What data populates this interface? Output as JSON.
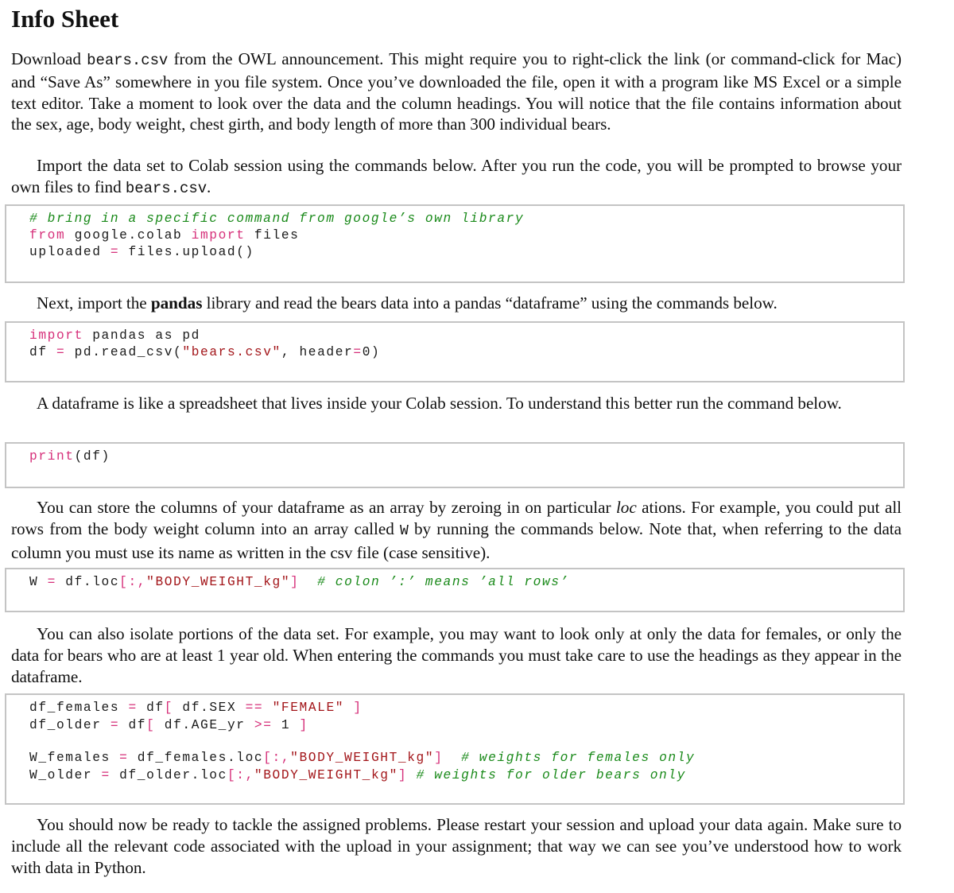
{
  "document": {
    "title": "Info Sheet",
    "sections": [
      {
        "id": "download",
        "paragraph_parts": {
          "p1_a": "Download ",
          "p1_code": "bears.csv",
          "p1_b": " from the OWL announcement. This might require you to right-click the link (or command-click for Mac) and “Save As” somewhere in you file system. Once you’ve downloaded the file, open it with a program like MS Excel or a simple text editor. Take a moment to look over the data and the column headings. You will notice that the file contains information about the sex, age, body weight, chest girth, and body length of more than 300 individual bears.",
          "p2_a": "Import the data set to Colab session using the commands below. After you run the code, you will be prompted to browse your own files to find ",
          "p2_code": "bears.csv",
          "p2_b": "."
        }
      },
      {
        "id": "pandas",
        "paragraph_parts": {
          "a": "Next, import the ",
          "bold": "pandas",
          "b": " library and read the bears data into a pandas “dataframe” using the commands below."
        }
      },
      {
        "id": "dataframe",
        "paragraph_parts": {
          "a": "A dataframe is like a spreadsheet that lives inside your Colab session. To understand this better run the command below."
        }
      },
      {
        "id": "loc",
        "paragraph_parts": {
          "a": "You can store the columns of your dataframe as an array by zeroing in on particular ",
          "italic": "loc",
          "b": " ations. For example, you could put all rows from the body weight column into an array called ",
          "code": "W",
          "c": " by running the commands below. Note that, when referring to the data column you must use its name as written in the csv file (case sensitive)."
        }
      },
      {
        "id": "isolate",
        "paragraph_parts": {
          "a": "You can also isolate portions of the data set. For example, you may want to look only at only the data for females, or only the data for bears who are at least 1 year old. When entering the commands you must take care to use the headings as they appear in the dataframe."
        }
      },
      {
        "id": "closing",
        "paragraph_parts": {
          "a": "You should now be ready to tackle the assigned problems. Please restart your session and upload your data again. Make sure to include all the relevant code associated with the upload in your assignment; that way we can see you’ve understood how to work with data in Python."
        }
      }
    ],
    "code_blocks": {
      "upload": {
        "l1_comment": "# bring in a specific command from google’s own library",
        "l2_kw1": "from",
        "l2_mid": " google.colab ",
        "l2_kw2": "import",
        "l2_end": " files",
        "l3_a": "uploaded ",
        "l3_op": "=",
        "l3_b": " files.upload()"
      },
      "read_csv": {
        "l1_kw": "import",
        "l1_end": " pandas as pd",
        "l2_a": "df ",
        "l2_op": "=",
        "l2_b": " pd.read_csv(",
        "l2_str": "\"bears.csv\"",
        "l2_c": ", header",
        "l2_op2": "=",
        "l2_d": "0)"
      },
      "print": {
        "l1_kw": "print",
        "l1_end": "(df)"
      },
      "loc": {
        "l1_a": "W ",
        "l1_op": "=",
        "l1_b": " df.loc",
        "l1_br1": "[:,",
        "l1_str": "\"BODY_WEIGHT_kg\"",
        "l1_br2": "]",
        "l1_sp": "  ",
        "l1_comment": "# colon ’:’ means ’all rows’"
      },
      "filters": {
        "l1_a": "df_females ",
        "l1_op": "=",
        "l1_b": " df",
        "l1_br1": "[",
        "l1_c": " df.SEX ",
        "l1_op2": "==",
        "l1_sp": " ",
        "l1_str": "\"FEMALE\"",
        "l1_sp2": " ",
        "l1_br2": "]",
        "l2_a": "df_older ",
        "l2_op": "=",
        "l2_b": " df",
        "l2_br1": "[",
        "l2_c": " df.AGE_yr ",
        "l2_op2": ">=",
        "l2_d": " 1 ",
        "l2_br2": "]",
        "l3_a": "W_females ",
        "l3_op": "=",
        "l3_b": " df_females.loc",
        "l3_br1": "[:,",
        "l3_str": "\"BODY_WEIGHT_kg\"",
        "l3_br2": "]",
        "l3_sp": "  ",
        "l3_comment": "# weights for females only",
        "l4_a": "W_older ",
        "l4_op": "=",
        "l4_b": " df_older.loc",
        "l4_br1": "[:,",
        "l4_str": "\"BODY_WEIGHT_kg\"",
        "l4_br2": "]",
        "l4_sp": " ",
        "l4_comment": "# weights for older bears only"
      }
    }
  }
}
